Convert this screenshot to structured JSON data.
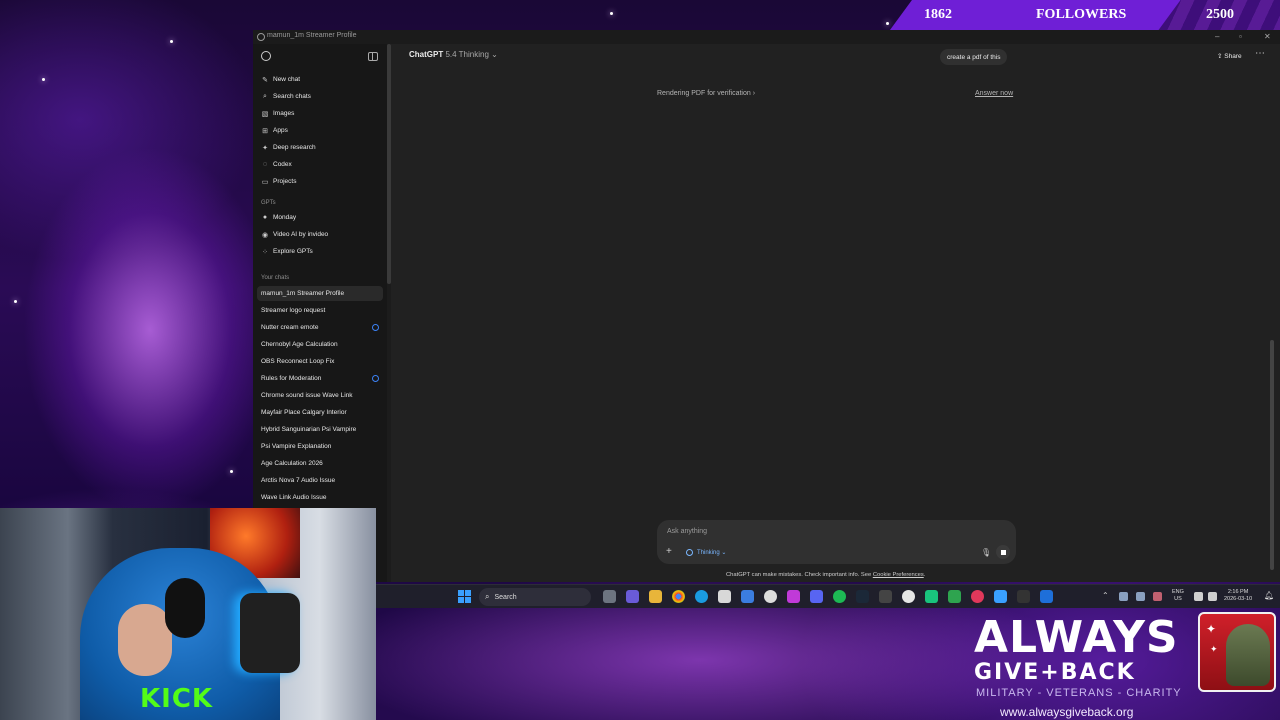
{
  "followers": {
    "current": "1862",
    "label": "FOLLOWERS",
    "goal": "2500",
    "progress": 0.745
  },
  "window": {
    "title": "mamun_1m Streamer Profile"
  },
  "sidebar": {
    "top_items": [
      {
        "label": "New chat",
        "icon": "new-chat-icon"
      },
      {
        "label": "Search chats",
        "icon": "search-icon"
      },
      {
        "label": "Images",
        "icon": "image-icon"
      },
      {
        "label": "Apps",
        "icon": "apps-icon"
      },
      {
        "label": "Deep research",
        "icon": "deep-research-icon"
      },
      {
        "label": "Codex",
        "icon": "codex-icon"
      },
      {
        "label": "Projects",
        "icon": "folder-icon"
      }
    ],
    "gpts_heading": "GPTs",
    "gpts": [
      {
        "label": "Monday",
        "icon": "monday-avatar-icon"
      },
      {
        "label": "Video AI by invideo",
        "icon": "invideo-icon"
      },
      {
        "label": "Explore GPTs",
        "icon": "explore-grid-icon"
      }
    ],
    "chats_heading": "Your chats",
    "chats": [
      {
        "label": "mamun_1m Streamer Profile",
        "active": true,
        "pending": false
      },
      {
        "label": "Streamer logo request",
        "active": false,
        "pending": false
      },
      {
        "label": "Nutter cream emote",
        "active": false,
        "pending": true
      },
      {
        "label": "Chernobyl Age Calculation",
        "active": false,
        "pending": false
      },
      {
        "label": "OBS Reconnect Loop Fix",
        "active": false,
        "pending": false
      },
      {
        "label": "Rules for Moderation",
        "active": false,
        "pending": true
      },
      {
        "label": "Chrome sound issue Wave Link",
        "active": false,
        "pending": false
      },
      {
        "label": "Mayfair Place Calgary Interior",
        "active": false,
        "pending": false
      },
      {
        "label": "Hybrid Sanguinarian Psi Vampire",
        "active": false,
        "pending": false
      },
      {
        "label": "Psi Vampire Explanation",
        "active": false,
        "pending": false
      },
      {
        "label": "Age Calculation 2026",
        "active": false,
        "pending": false
      },
      {
        "label": "Arctis Nova 7 Audio Issue",
        "active": false,
        "pending": false
      },
      {
        "label": "Wave Link Audio Issue",
        "active": false,
        "pending": false
      }
    ]
  },
  "header": {
    "model_name": "ChatGPT",
    "model_version": "5.4 Thinking",
    "share_label": "Share"
  },
  "conversation": {
    "user_message": "create a pdf of this",
    "status": "Rendering PDF for verification",
    "answer_now": "Answer now"
  },
  "composer": {
    "placeholder": "Ask anything",
    "mode_label": "Thinking"
  },
  "disclaimer": {
    "text": "ChatGPT can make mistakes. Check important info. See ",
    "link": "Cookie Preferences",
    "end": "."
  },
  "taskbar": {
    "search_label": "Search",
    "lang_top": "ENG",
    "lang_bottom": "US",
    "time": "2:16 PM",
    "date": "2026-03-10"
  },
  "overlay": {
    "brand_line1": "ALWAYS",
    "brand_line2": "GIVE+BACK",
    "brand_tagline": "MILITARY - VETERANS - CHARITY",
    "brand_url": "www.alwaysgiveback.org",
    "cam_shirt_text": "KICK"
  },
  "colors": {
    "accent_purple": "#6f1fd6",
    "pending_dot": "#3b82f6",
    "thinking": "#7ab7ff",
    "brand_red": "#d0202a"
  }
}
